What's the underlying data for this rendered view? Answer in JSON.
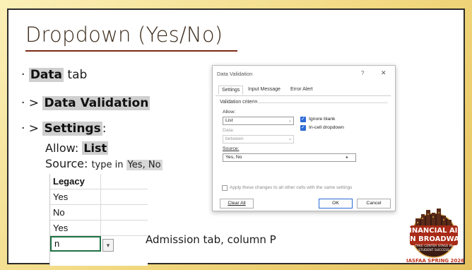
{
  "slide": {
    "title": "Dropdown (Yes/No)",
    "bullets": [
      {
        "prefix": "· ",
        "pre": "",
        "highlight": "Data",
        "post": " tab"
      },
      {
        "prefix": "· > ",
        "pre": "",
        "highlight": "Data Validation",
        "post": ""
      },
      {
        "prefix": "· > ",
        "pre": "",
        "highlight": "Settings",
        "post": ":"
      }
    ],
    "allow_label": "Allow: ",
    "allow_value": "List",
    "source_label": "Source: ",
    "source_hint": "type in ",
    "source_value": "Yes, No",
    "caption": "Admission tab, column P"
  },
  "dialog": {
    "title": "Data Validation",
    "help": "?",
    "close": "✕",
    "tabs": [
      "Settings",
      "Input Message",
      "Error Alert"
    ],
    "criteria_label": "Validation criteria",
    "allow_label": "Allow:",
    "allow_value": "List",
    "data_label": "Data:",
    "data_value": "between",
    "source_label": "Source:",
    "source_value": "Yes, No",
    "ignore_blank": "Ignore blank",
    "in_cell_dropdown": "In-cell dropdown",
    "apply_all": "Apply these changes to all other cells with the same settings",
    "clear_all": "Clear All",
    "ok": "OK",
    "cancel": "Cancel"
  },
  "sheet": {
    "header": "Legacy",
    "rows": [
      "Yes",
      "No",
      "Yes"
    ],
    "active_value": "n",
    "dropdown_glyph": "▾"
  },
  "logo": {
    "line1": "FINANCIAL AID",
    "line2": "ON BROADWAY",
    "line3": "TAKE CENTER STAGE IN",
    "line4": "STUDENT SUCCESS",
    "footer": "IASFAA SPRING 2026"
  },
  "colors": {
    "frame_bg": "#ffffff",
    "slide_bg": "#f1d77e",
    "title_rule": "#7b2a17",
    "highlight": "#cfcfcf",
    "checkbox": "#2d6ad6",
    "excel_green": "#1e7145",
    "logo_dark": "#3a1a12",
    "logo_accent": "#c0341d"
  }
}
